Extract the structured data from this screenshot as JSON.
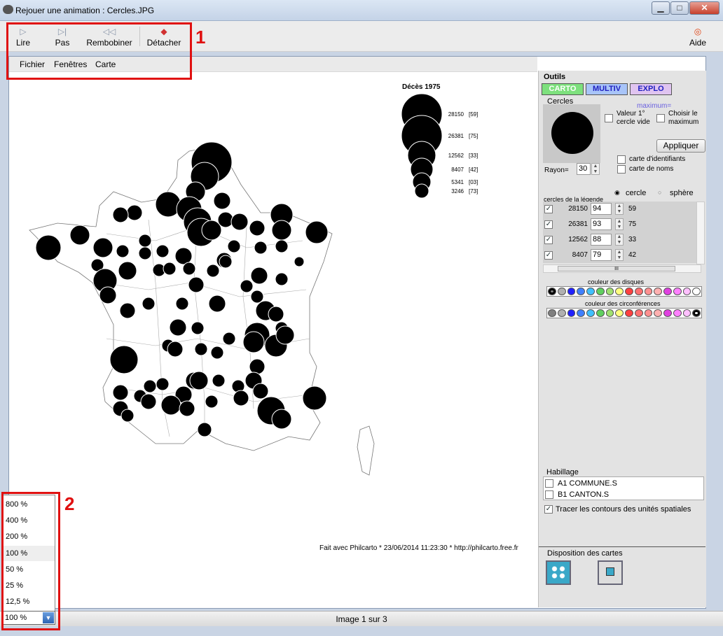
{
  "window": {
    "title": "Rejouer une animation :  Cercles.JPG",
    "minimize": "▁",
    "maximize": "□",
    "close": "✕"
  },
  "toolbar": {
    "play": "Lire",
    "step": "Pas",
    "rewind": "Rembobiner",
    "detach": "Détacher",
    "help": "Aide"
  },
  "menu": {
    "file": "Fichier",
    "windows": "Fenêtres",
    "map": "Carte"
  },
  "annotations": {
    "one": "1",
    "two": "2"
  },
  "map": {
    "legend_title": "Décès 1975",
    "legend": [
      {
        "value": "28150",
        "code": "[59]"
      },
      {
        "value": "26381",
        "code": "[75]"
      },
      {
        "value": "12562",
        "code": "[33]"
      },
      {
        "value": "8407",
        "code": "[42]"
      },
      {
        "value": "5341",
        "code": "[03]"
      },
      {
        "value": "3246",
        "code": "[73]"
      }
    ],
    "credits": "Fait avec Philcarto * 23/06/2014 11:23:30 * http://philcarto.free.fr"
  },
  "panel": {
    "title": "Outils",
    "tabs": [
      "CARTO",
      "MULTIV",
      "EXPLO"
    ],
    "tab_colors": [
      "#7de07d",
      "#a8c4f8",
      "#e0c4f0"
    ],
    "circles_label": "Cercles",
    "maximum_label": "maximum=",
    "first_value_empty": "Valeur 1° cercle vide",
    "choose_max": "Choisir le maximum",
    "apply": "Appliquer",
    "id_map": "carte d'identifiants",
    "names_map": "carte de noms",
    "radius_label": "Rayon=",
    "radius_value": "30",
    "shape_circle": "cercle",
    "shape_sphere": "sphère",
    "legend_circles_label": "cercles de la légende",
    "legend_rows": [
      {
        "value": "28150",
        "pct": "94",
        "code": "59"
      },
      {
        "value": "26381",
        "pct": "93",
        "code": "75"
      },
      {
        "value": "12562",
        "pct": "88",
        "code": "33"
      },
      {
        "value": "8407",
        "pct": "79",
        "code": "42"
      }
    ],
    "scroll_thumb": "III",
    "disk_color_label": "couleur des disques",
    "circ_color_label": "couleur des circonférences",
    "palette": [
      "#808080",
      "#b0b0b0",
      "#2020ff",
      "#4080ff",
      "#40c0ff",
      "#60d060",
      "#a0e070",
      "#ffff80",
      "#ff4040",
      "#ff7070",
      "#ff9090",
      "#ffb0b0",
      "#e040e0",
      "#ff80ff",
      "#ffc0ff",
      "#ffffff"
    ],
    "dressing_label": "Habillage",
    "layers": [
      "A1  COMMUNE.S",
      "B1  CANTON.S"
    ],
    "draw_outlines": "Tracer les contours des unités spatiales",
    "layout_label": "Disposition des cartes"
  },
  "zoom": {
    "options": [
      "800 %",
      "400 %",
      "200 %",
      "100 %",
      "50 %",
      "25 %",
      "12,5 %"
    ],
    "selected": "100 %"
  },
  "status": {
    "text": "Image 1 sur 3"
  }
}
